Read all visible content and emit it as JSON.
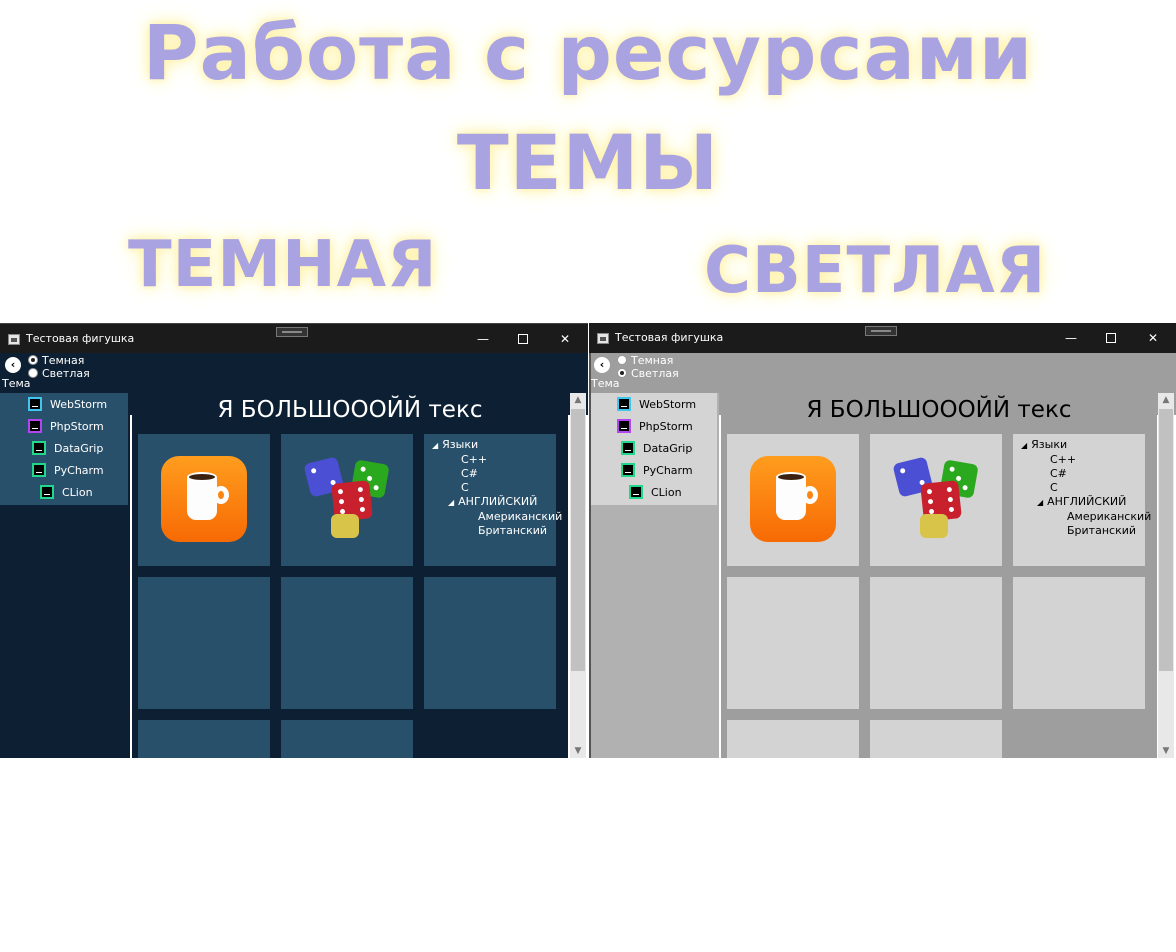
{
  "headings": {
    "line1": "Работа с ресурсами",
    "line2": "ТЕМЫ",
    "dark_label": "ТЕМНАЯ",
    "light_label": "СВЕТЛАЯ"
  },
  "colors": {
    "heading": "#a9a3e2",
    "heading_glow": "#fff4b8",
    "dark_bg": "#0c1f33",
    "dark_panel": "#29506a",
    "light_bg": "#9e9e9e",
    "light_panel": "#d3d3d3"
  },
  "window": {
    "title": "Тестовая фигушка",
    "min": "—",
    "close": "✕"
  },
  "theme_switch": {
    "option_dark": "Темная",
    "option_light": "Светлая",
    "label": "Тема",
    "back": "‹"
  },
  "menu": {
    "items": [
      {
        "label": "WebStorm",
        "icon": "webstorm-icon"
      },
      {
        "label": "PhpStorm",
        "icon": "phpstorm-icon"
      },
      {
        "label": "DataGrip",
        "icon": "datagrip-icon"
      },
      {
        "label": "PyCharm",
        "icon": "pycharm-icon"
      },
      {
        "label": "CLion",
        "icon": "clion-icon"
      }
    ]
  },
  "content": {
    "big_text": "Я БОЛЬШОООЙЙ текс",
    "tree": {
      "root": "Языки",
      "children": [
        "C++",
        "C#",
        "C"
      ],
      "english": "АНГЛИЙСКИЙ",
      "english_children": [
        "Американский",
        "Британский"
      ]
    }
  },
  "scroll": {
    "up": "▲",
    "down": "▼"
  }
}
